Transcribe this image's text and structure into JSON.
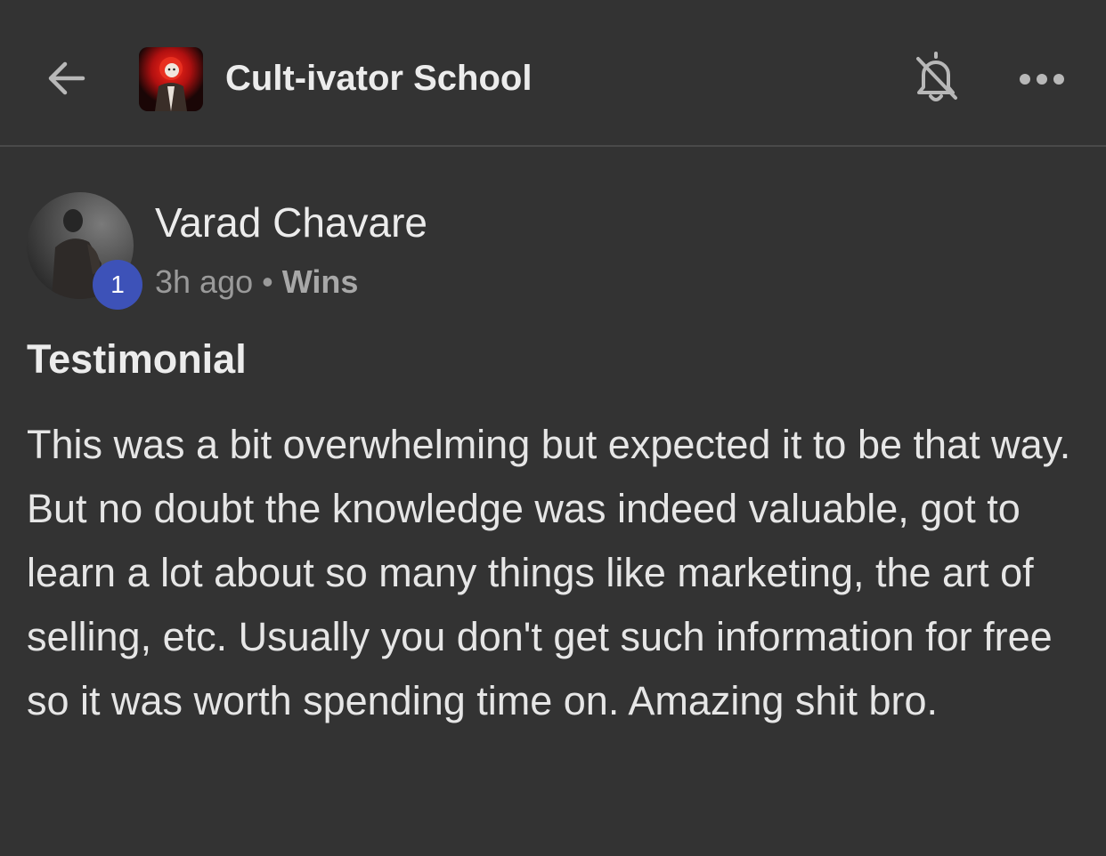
{
  "header": {
    "back_icon": "arrow-left-icon",
    "group_name": "Cult-ivator School",
    "group_logo_icon": "group-logo",
    "notification_icon": "bell-off-icon",
    "more_icon": "more-horizontal-icon"
  },
  "post": {
    "author": {
      "name": "Varad Chavare",
      "level": "1",
      "level_badge_color": "#3d52b8"
    },
    "time": "3h ago",
    "separator": "•",
    "category": "Wins",
    "title": "Testimonial",
    "body": "This was a bit overwhelming but expected it to be that way. But no doubt the knowledge was indeed valuable, got to learn a lot about so many things like marketing, the art of selling, etc. Usually you don't get such information for free so it was worth spending time on. Amazing shit bro."
  },
  "colors": {
    "background": "#333333",
    "text_primary": "#ececec",
    "text_secondary": "#9a9a9a",
    "divider": "#4a4a4a"
  }
}
